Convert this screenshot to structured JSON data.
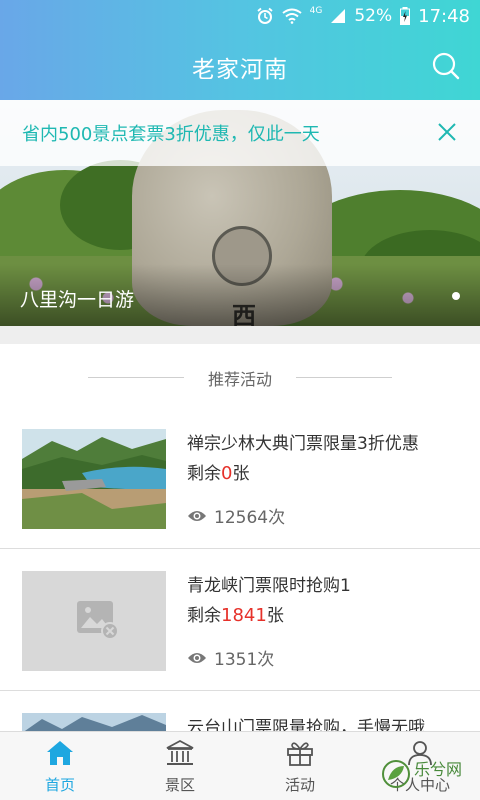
{
  "status_bar": {
    "battery": "52%",
    "time": "17:48",
    "network": "4G"
  },
  "header": {
    "title": "老家河南"
  },
  "notice": {
    "text": "省内500景点套票3折优惠，仅此一天"
  },
  "banner": {
    "caption": "八里沟一日游"
  },
  "section": {
    "title": "推荐活动"
  },
  "activities": [
    {
      "title": "禅宗少林大典门票限量3折优惠",
      "remain_prefix": "剩余",
      "remain": "0",
      "remain_suffix": "张",
      "views": "12564次",
      "thumb": "lake-photo"
    },
    {
      "title": "青龙峡门票限时抢购1",
      "remain_prefix": "剩余",
      "remain": "1841",
      "remain_suffix": "张",
      "views": "1351次",
      "thumb": "image-placeholder"
    },
    {
      "title": "云台山门票限量抢购，手慢无哦",
      "thumb": "mountain-photo"
    }
  ],
  "tabs": [
    {
      "label": "首页",
      "icon": "home-icon",
      "active": true
    },
    {
      "label": "景区",
      "icon": "building-icon",
      "active": false
    },
    {
      "label": "活动",
      "icon": "gift-icon",
      "active": false
    },
    {
      "label": "个人中心",
      "icon": "user-icon",
      "active": false
    }
  ],
  "watermark": {
    "text": "乐兮网"
  },
  "colors": {
    "accent": "#1ea7e0",
    "notice": "#1fb8b2",
    "count_red": "#e6312a",
    "gradient_start": "#69a7e8",
    "gradient_end": "#3fd6d4"
  }
}
